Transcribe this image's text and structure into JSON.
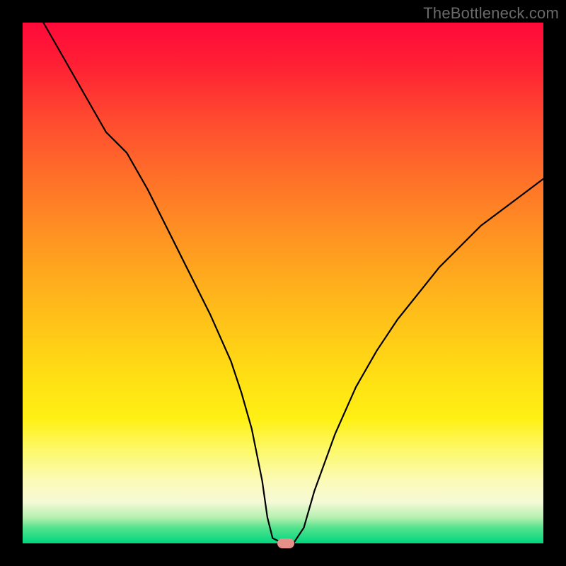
{
  "watermark": "TheBottleneck.com",
  "chart_data": {
    "type": "line",
    "title": "",
    "xlabel": "",
    "ylabel": "",
    "xlim": [
      0,
      100
    ],
    "ylim": [
      0,
      100
    ],
    "background_gradient": {
      "top_color": "#ff0a3a",
      "mid_color": "#ffe014",
      "bottom_color": "#00d77f"
    },
    "x": [
      4,
      8,
      12,
      16,
      18,
      20,
      24,
      28,
      32,
      36,
      40,
      42,
      44,
      46,
      47,
      48,
      50,
      52,
      54,
      56,
      60,
      64,
      68,
      72,
      76,
      80,
      84,
      88,
      92,
      96,
      100
    ],
    "values": [
      100,
      93,
      86,
      79,
      77,
      75,
      68,
      60,
      52,
      44,
      35,
      29,
      22,
      12,
      5,
      1,
      0,
      0,
      3,
      10,
      21,
      30,
      37,
      43,
      48,
      53,
      57,
      61,
      64,
      67,
      70
    ],
    "minimum_marker": {
      "x": 50.5,
      "y": 0,
      "color": "#e79089"
    }
  }
}
